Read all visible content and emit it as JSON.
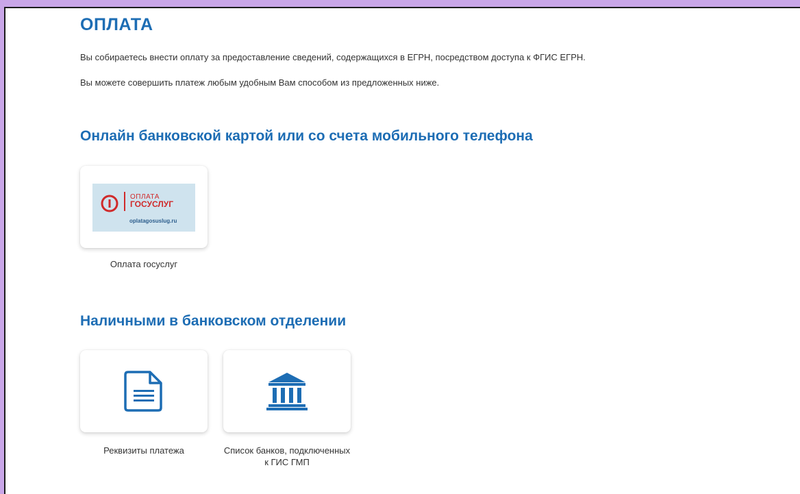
{
  "page": {
    "title": "ОПЛАТА",
    "intro_line_1": "Вы собираетесь внести оплату за предоставление сведений, содержащихся в ЕГРН, посредством доступа к ФГИС ЕГРН.",
    "intro_line_2": "Вы можете совершить платеж любым удобным Вам способом из предложенных ниже."
  },
  "sections": {
    "online": {
      "heading": "Онлайн банковской картой или со счета мобильного телефона",
      "cards": [
        {
          "caption": "Оплата госуслуг",
          "icon": "oplata-gosuslug-logo",
          "logo_text_1": "ОПЛАТА",
          "logo_text_2": "ГОСУСЛУГ",
          "logo_url": "oplatagosuslug.ru"
        }
      ]
    },
    "cash": {
      "heading": "Наличными в банковском отделении",
      "cards": [
        {
          "caption": "Реквизиты платежа",
          "icon": "document-icon"
        },
        {
          "caption": "Список банков, подключенных к ГИС ГМП",
          "icon": "bank-icon"
        }
      ]
    }
  },
  "colors": {
    "accent": "#1d6db4",
    "text": "#333333",
    "logo_red": "#d02a2a",
    "logo_bg": "#cfe3ee",
    "outer_background": "#c9a6e8"
  }
}
